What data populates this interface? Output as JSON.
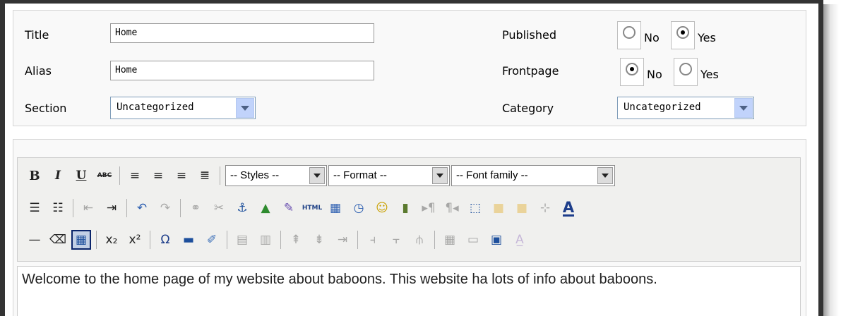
{
  "form": {
    "title_label": "Title",
    "title_value": "Home",
    "alias_label": "Alias",
    "alias_value": "Home",
    "section_label": "Section",
    "section_value": "Uncategorized",
    "published_label": "Published",
    "published_no": "No",
    "published_yes": "Yes",
    "published_selected": "Yes",
    "frontpage_label": "Frontpage",
    "frontpage_no": "No",
    "frontpage_yes": "Yes",
    "frontpage_selected": "No",
    "category_label": "Category",
    "category_value": "Uncategorized"
  },
  "toolbar": {
    "styles": "-- Styles --",
    "format": "-- Format --",
    "font_family": "-- Font family --",
    "row1": [
      {
        "name": "bold-button",
        "glyph": "B",
        "style": "bold"
      },
      {
        "name": "italic-button",
        "glyph": "I",
        "style": "italic"
      },
      {
        "name": "underline-button",
        "glyph": "U",
        "style": "underline"
      },
      {
        "name": "strikethrough-button",
        "glyph": "ABC",
        "style": "strike"
      },
      {
        "sep": true
      },
      {
        "name": "align-left-button",
        "glyph": "≡"
      },
      {
        "name": "align-center-button",
        "glyph": "≡"
      },
      {
        "name": "align-right-button",
        "glyph": "≡"
      },
      {
        "name": "align-justify-button",
        "glyph": "≣"
      },
      {
        "sep": true
      }
    ],
    "row2": [
      {
        "name": "bullet-list-button",
        "glyph": "☰"
      },
      {
        "name": "numbered-list-button",
        "glyph": "☷"
      },
      {
        "sep": true
      },
      {
        "name": "outdent-button",
        "glyph": "⇤",
        "dim": true
      },
      {
        "name": "indent-button",
        "glyph": "⇥"
      },
      {
        "sep": true
      },
      {
        "name": "undo-button",
        "glyph": "↶",
        "color": "#2a5db0"
      },
      {
        "name": "redo-button",
        "glyph": "↷",
        "dim": true
      },
      {
        "sep": true
      },
      {
        "name": "insert-link-button",
        "glyph": "⚭",
        "dim": true
      },
      {
        "name": "unlink-button",
        "glyph": "✂",
        "dim": true
      },
      {
        "name": "anchor-button",
        "glyph": "⚓",
        "color": "#1d4f9c"
      },
      {
        "name": "insert-image-button",
        "glyph": "▲",
        "color": "#2e8b2e"
      },
      {
        "name": "cleanup-button",
        "glyph": "✎",
        "color": "#6a4fb0"
      },
      {
        "name": "html-source-button",
        "glyph": "HTML",
        "small": true,
        "color": "#224488"
      },
      {
        "name": "insert-date-button",
        "glyph": "▦",
        "color": "#2a5db0"
      },
      {
        "name": "insert-time-button",
        "glyph": "◷",
        "color": "#2a5db0"
      },
      {
        "name": "emoticons-button",
        "glyph": "☺",
        "color": "#c9a000"
      },
      {
        "name": "media-button",
        "glyph": "▮",
        "color": "#5b7a2e"
      },
      {
        "name": "ltr-button",
        "glyph": "▸¶",
        "dim": true
      },
      {
        "name": "rtl-button",
        "glyph": "¶◂",
        "dim": true
      },
      {
        "name": "visual-aid-button",
        "glyph": "⬚",
        "color": "#1d4f9c"
      },
      {
        "name": "layer-insert-button",
        "glyph": "■",
        "dim": true,
        "color": "#e0a000"
      },
      {
        "name": "layer-forward-button",
        "glyph": "■",
        "dim": true,
        "color": "#e0a000"
      },
      {
        "name": "layer-absolute-button",
        "glyph": "⊹",
        "dim": true
      },
      {
        "name": "font-color-button",
        "glyph": "A",
        "color": "#1d3d8a",
        "underline_color": "#1d3d8a"
      }
    ],
    "row3": [
      {
        "name": "horizontal-rule-button",
        "glyph": "—"
      },
      {
        "name": "remove-format-button",
        "glyph": "⌫"
      },
      {
        "name": "table-toggle-button",
        "glyph": "▦",
        "active": true,
        "color": "#1d4f9c"
      },
      {
        "sep": true
      },
      {
        "name": "subscript-button",
        "glyph": "x₂"
      },
      {
        "name": "superscript-button",
        "glyph": "x²"
      },
      {
        "sep": true
      },
      {
        "name": "special-char-button",
        "glyph": "Ω",
        "color": "#1d3d8a"
      },
      {
        "name": "insert-hr-button",
        "glyph": "▬",
        "color": "#1d4f9c"
      },
      {
        "name": "edit-css-button",
        "glyph": "✐",
        "color": "#3b6fb8"
      },
      {
        "sep": true
      },
      {
        "name": "table-row-props-button",
        "glyph": "▤",
        "dim": true
      },
      {
        "name": "table-cell-props-button",
        "glyph": "▥",
        "dim": true
      },
      {
        "sep": true
      },
      {
        "name": "insert-row-before-button",
        "glyph": "⇞",
        "dim": true
      },
      {
        "name": "insert-row-after-button",
        "glyph": "⇟",
        "dim": true
      },
      {
        "name": "delete-row-button",
        "glyph": "⇥",
        "dim": true
      },
      {
        "sep": true
      },
      {
        "name": "insert-col-before-button",
        "glyph": "⫞",
        "dim": true
      },
      {
        "name": "insert-col-after-button",
        "glyph": "⫟",
        "dim": true
      },
      {
        "name": "delete-col-button",
        "glyph": "⫛",
        "dim": true
      },
      {
        "sep": true
      },
      {
        "name": "split-cells-button",
        "glyph": "▦",
        "dim": true
      },
      {
        "name": "merge-cells-button",
        "glyph": "▭",
        "dim": true
      },
      {
        "name": "insert-layer-button",
        "glyph": "▣",
        "color": "#1d4f9c"
      },
      {
        "name": "style-props-button",
        "glyph": "A̲",
        "dim": true,
        "color": "#7a4fb0"
      }
    ]
  },
  "content": {
    "text": "Welcome to the home page of my website about baboons. This website ha lots of info about baboons."
  }
}
